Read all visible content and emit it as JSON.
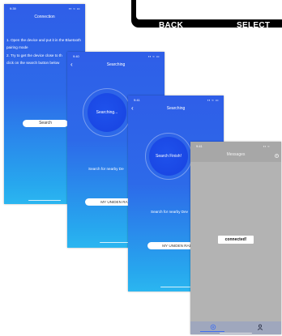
{
  "device": {
    "back_label": "BACK",
    "select_label": "SELECT"
  },
  "screens": {
    "connection": {
      "status_time": "9:39",
      "status_icons": "▪▪ ≈ ▭",
      "title": "Connection",
      "instructions": [
        "1. Open the device  and put it in the Bluetooth",
        "pairing mode",
        "2. Try to get the device close to th",
        "click on the search button below"
      ],
      "search_button": "Search"
    },
    "searching": {
      "status_time": "9:40",
      "status_icons": "▪▪ ≈ ▭",
      "back_glyph": "‹",
      "title": "Searching",
      "circle_text": "Searching...",
      "hint": "Search for nearby De",
      "device_button": "MY UNIDEN RADIO"
    },
    "search_finish": {
      "status_time": "9:41",
      "status_icons": "▪▪ ≈ ▭",
      "back_glyph": "‹",
      "title": "Searching",
      "circle_text": "Search Finish!",
      "hint": "Search for nearby Dev",
      "device_button": "MY UNIDEN RADIO"
    },
    "messages": {
      "status_time": "9:41",
      "status_icons": "▪▪ ≈",
      "title": "Messages",
      "toast": "connected!",
      "tabs": [
        "settings-icon",
        "profile-icon"
      ],
      "colors": {
        "header": "#a7a7a7",
        "body": "#b3b3b3",
        "tabbar": "#9fa7bd"
      }
    }
  },
  "colors": {
    "gradient_top": "#2f5ee8",
    "gradient_bottom": "#2bb6f0",
    "circle": "#1a47e4"
  }
}
